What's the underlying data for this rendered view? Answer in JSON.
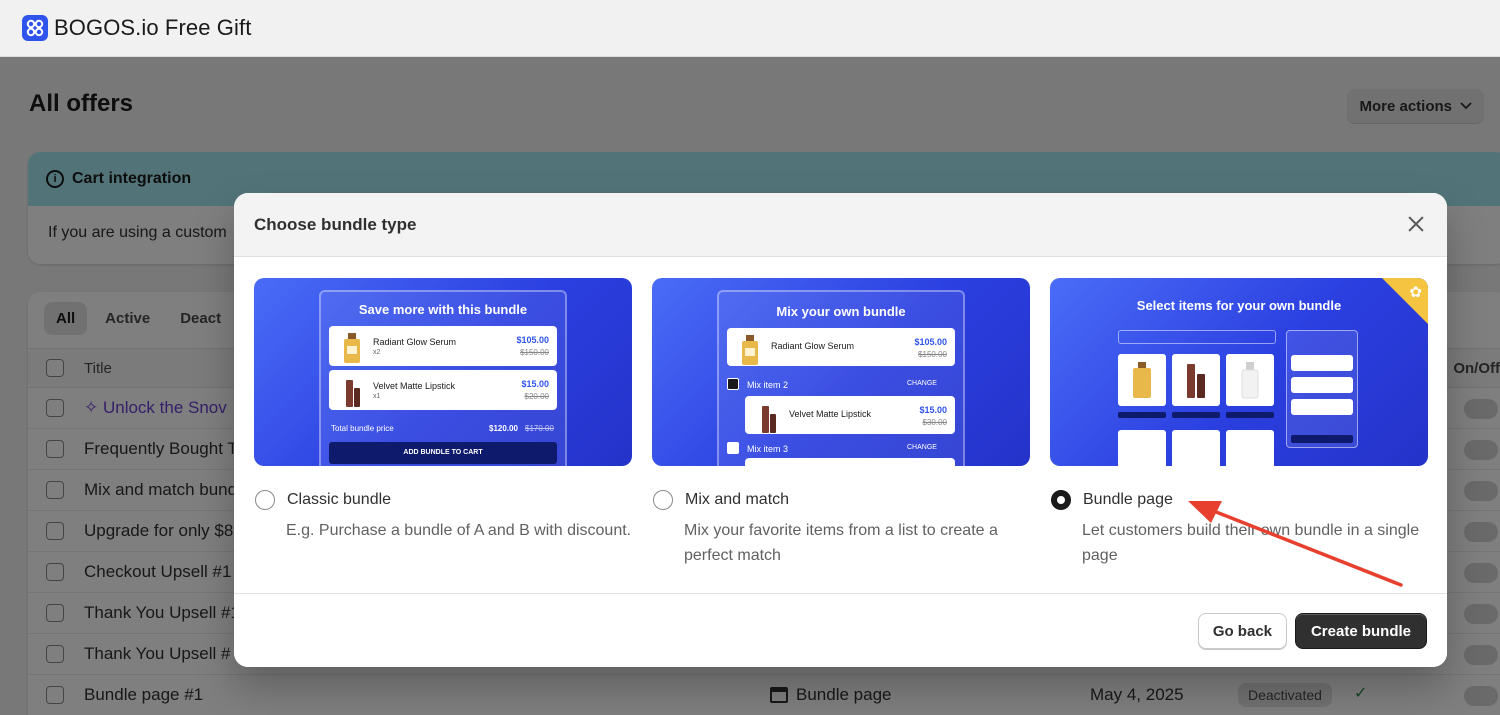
{
  "app": {
    "title": "BOGOS.io Free Gift"
  },
  "page": {
    "title": "All offers",
    "more_actions": "More actions",
    "banner": {
      "title": "Cart integration",
      "body": "If you are using a custom"
    },
    "tabs": [
      "All",
      "Active",
      "Deact"
    ],
    "table": {
      "col_title": "Title",
      "col_onoff": "On/Off",
      "rows": [
        {
          "name": "Unlock the Snov"
        },
        {
          "name": "Frequently Bought T"
        },
        {
          "name": "Mix and match bund"
        },
        {
          "name": "Upgrade for only $8"
        },
        {
          "name": "Checkout Upsell #1"
        },
        {
          "name": "Thank You Upsell #1"
        },
        {
          "name": "Thank You Upsell #"
        },
        {
          "name": "Bundle page #1",
          "type": "Bundle page",
          "date": "May 4, 2025",
          "status": "Deactivated"
        }
      ]
    }
  },
  "modal": {
    "title": "Choose bundle type",
    "options": [
      {
        "label": "Classic bundle",
        "description": "E.g. Purchase a bundle of A and B with discount.",
        "selected": false,
        "preview": {
          "heading": "Save more with this bundle",
          "items": [
            {
              "name": "Radiant Glow Serum",
              "qty": "x2",
              "price": "$105.00",
              "old": "$150.00"
            },
            {
              "name": "Velvet Matte Lipstick",
              "qty": "x1",
              "price": "$15.00",
              "old": "$20.00"
            }
          ],
          "total_label": "Total bundle price",
          "total_value": "$120.00",
          "total_old": "$170.00",
          "button": "ADD BUNDLE TO CART"
        }
      },
      {
        "label": "Mix and match",
        "description": "Mix your favorite items from a list to create a perfect match",
        "selected": false,
        "preview": {
          "heading": "Mix your own bundle",
          "item1": {
            "name": "Radiant Glow Serum",
            "price": "$105.00",
            "old": "$150.00"
          },
          "mix2": "Mix item 2",
          "mix3": "Mix item 3",
          "change": "CHANGE",
          "item2": {
            "name": "Velvet Matte Lipstick",
            "price": "$15.00",
            "old": "$30.00"
          }
        }
      },
      {
        "label": "Bundle page",
        "description": "Let customers build their own bundle in a single page",
        "selected": true,
        "preview": {
          "heading": "Select items for your own bundle"
        }
      }
    ],
    "buttons": {
      "back": "Go back",
      "create": "Create bundle"
    }
  },
  "colors": {
    "accent": "#2f54eb",
    "annotation_arrow": "#e8402f",
    "primary_button": "#303030"
  }
}
